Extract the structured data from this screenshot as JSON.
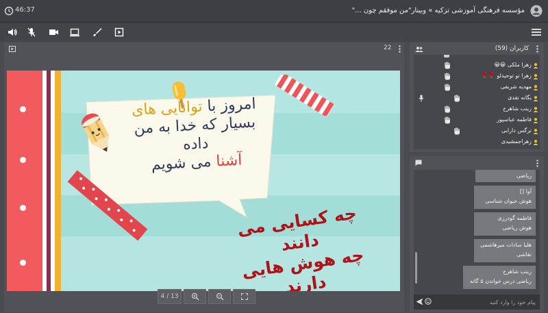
{
  "header": {
    "time": "46:37",
    "title": "مؤسسه فرهنگی آموزشی تزکیه » وبینار\"من موفقم چون ...\""
  },
  "toolbar": {
    "icons": [
      "speaker-icon",
      "mic-muted-icon",
      "video-icon",
      "screen-share-icon",
      "pen-icon",
      "play-box-icon",
      "menu-icon"
    ]
  },
  "presentation": {
    "slide_number": "22",
    "page_indicator": "4 / 13",
    "slide_text": {
      "card_line1_a": "امروز با ",
      "card_line1_b": "توانایی های",
      "card_line2": "بسیار که خدا به من",
      "card_line3": "داده",
      "card_line4_a": "آشنا",
      "card_line4_b": " می شویم",
      "red_line1": "چه کسایی می",
      "red_line2": "دانند",
      "red_line3": "چه هوش هایی",
      "red_line4": "دارند"
    },
    "colors": {
      "text_dark": "#2f3b5a",
      "text_gold": "#d9a31c",
      "text_red": "#e0413d",
      "text_dark_red": "#b0121a"
    }
  },
  "users": {
    "title": "کاربران (59)",
    "list": [
      {
        "name": "زهرا ملکی 😀😀"
      },
      {
        "name": "زهرا تو توحیدلو 🌹🌹"
      },
      {
        "name": "مهدیه شریفی"
      },
      {
        "name": "یگانه نقدی"
      },
      {
        "name": "زینب شاهرخ"
      },
      {
        "name": "فاطمه عباسپور"
      },
      {
        "name": "نرگس دارابی"
      },
      {
        "name": "زهراجمشیدی"
      }
    ]
  },
  "chat": {
    "messages": [
      {
        "name": "",
        "text": "ریاضی"
      },
      {
        "name": "آوا []",
        "text": "هوش حیوان شناسی"
      },
      {
        "name": "فاطمه گودرزی",
        "text": "هوش ریاضی"
      },
      {
        "name": "هلیا سادات میرهاشمی",
        "text": "نقاشی"
      },
      {
        "name": "زینب شاهرخ",
        "text": "ریاضی درس خواندن ۵ گانه"
      }
    ],
    "input_placeholder": "پیام خود را وارد کنید"
  }
}
